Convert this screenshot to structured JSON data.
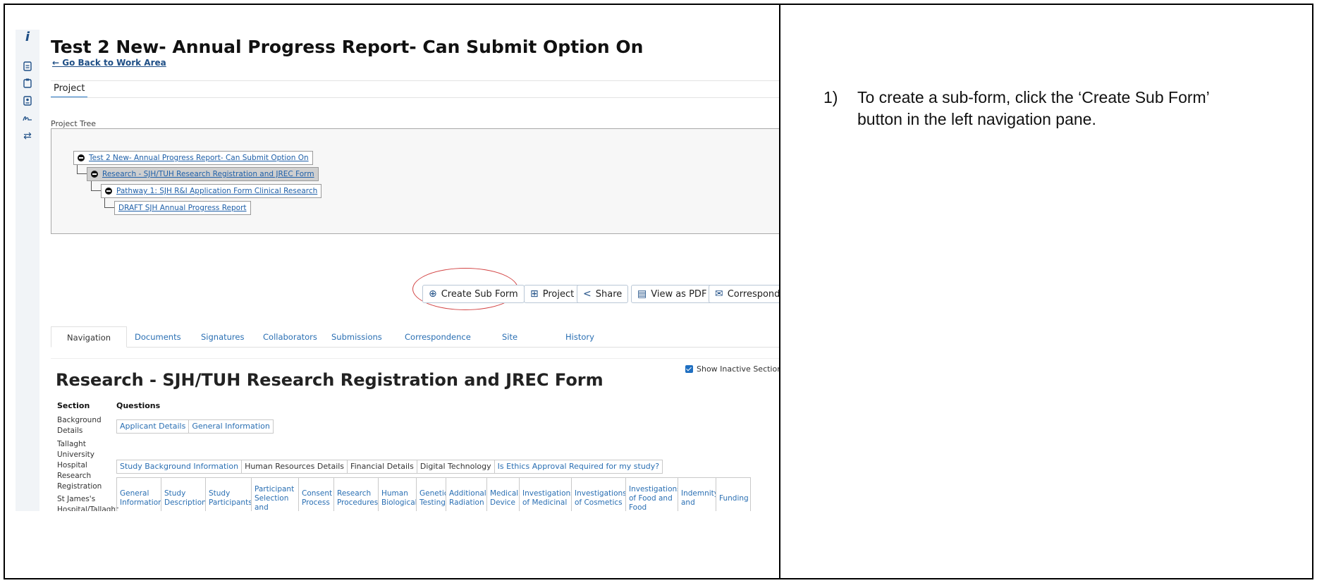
{
  "page": {
    "title": "Test 2 New- Annual Progress Report- Can Submit Option On",
    "back_link": "← Go Back to Work Area",
    "top_tab": "Project"
  },
  "rail_icons": [
    "info-icon",
    "document-icon",
    "clipboard-icon",
    "form-icon",
    "signature-icon",
    "transfer-icon"
  ],
  "tree": {
    "label": "Project Tree",
    "nodes": [
      {
        "label": "Test 2 New- Annual Progress Report- Can Submit Option On"
      },
      {
        "label": "Research - SJH/TUH Research Registration and JREC Form"
      },
      {
        "label": "Pathway 1: SJH R&I Application Form Clinical Research"
      },
      {
        "label": "DRAFT SJH Annual Progress Report"
      }
    ]
  },
  "actions": {
    "create_sub_form": "Create Sub Form",
    "project": "Project",
    "share": "Share",
    "view_pdf": "View as PDF",
    "correspond": "Correspond"
  },
  "tabs": [
    "Navigation",
    "Documents",
    "Signatures",
    "Collaborators",
    "Submissions",
    "Correspondence",
    "Site",
    "History"
  ],
  "form": {
    "show_inactive": "Show Inactive Sections",
    "title": "Research - SJH/TUH Research Registration and JREC Form",
    "section_header": "Section",
    "questions_header": "Questions",
    "sections": [
      {
        "name": "Background Details",
        "questions": [
          "Applicant Details",
          "General Information"
        ]
      },
      {
        "name": "Tallaght University Hospital Research Registration",
        "questions": [
          "Study Background Information",
          "Human Resources Details",
          "Financial Details",
          "Digital Technology",
          "Is Ethics Approval Required for my study?"
        ]
      },
      {
        "name": "St James's Hospital/Tallaght University Hospital Research Ethics",
        "questions": [
          "General Information",
          "Study Description",
          "Study Participants",
          "Participant Selection and",
          "Consent Process",
          "Research Procedures",
          "Human Biological",
          "Genetic Testing",
          "Additional Radiation",
          "Medical Device",
          "Investigations of Medicinal",
          "Investigations of Cosmetics",
          "Investigations of Food and Food",
          "Indemnity and",
          "Funding"
        ]
      }
    ]
  },
  "instructions": {
    "step_number": "1)",
    "line1": "To create a sub-form, click the ‘Create Sub Form’",
    "line2": "button in the left navigation pane."
  }
}
